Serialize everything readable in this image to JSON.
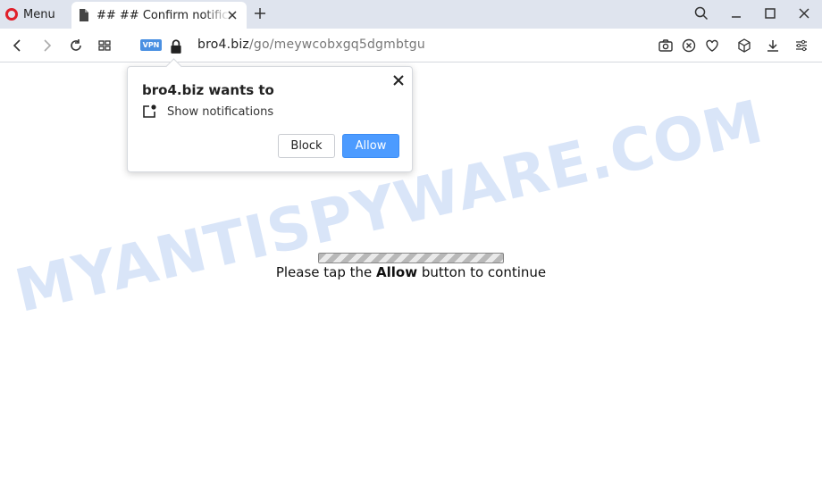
{
  "browser": {
    "menu_label": "Menu",
    "tab_title": "## ## Confirm notifications",
    "vpn_label": "VPN",
    "url_host": "bro4.biz",
    "url_path": "/go/meywcobxgq5dgmbtgu",
    "brand_color": "#e0202a",
    "accent_color": "#4c9bff"
  },
  "popup": {
    "title": "bro4.biz wants to",
    "permission": "Show notifications",
    "block_label": "Block",
    "allow_label": "Allow"
  },
  "page": {
    "message_before": "Please tap the ",
    "message_bold": "Allow",
    "message_after": " button to continue",
    "watermark": "MYANTISPYWARE.COM"
  }
}
